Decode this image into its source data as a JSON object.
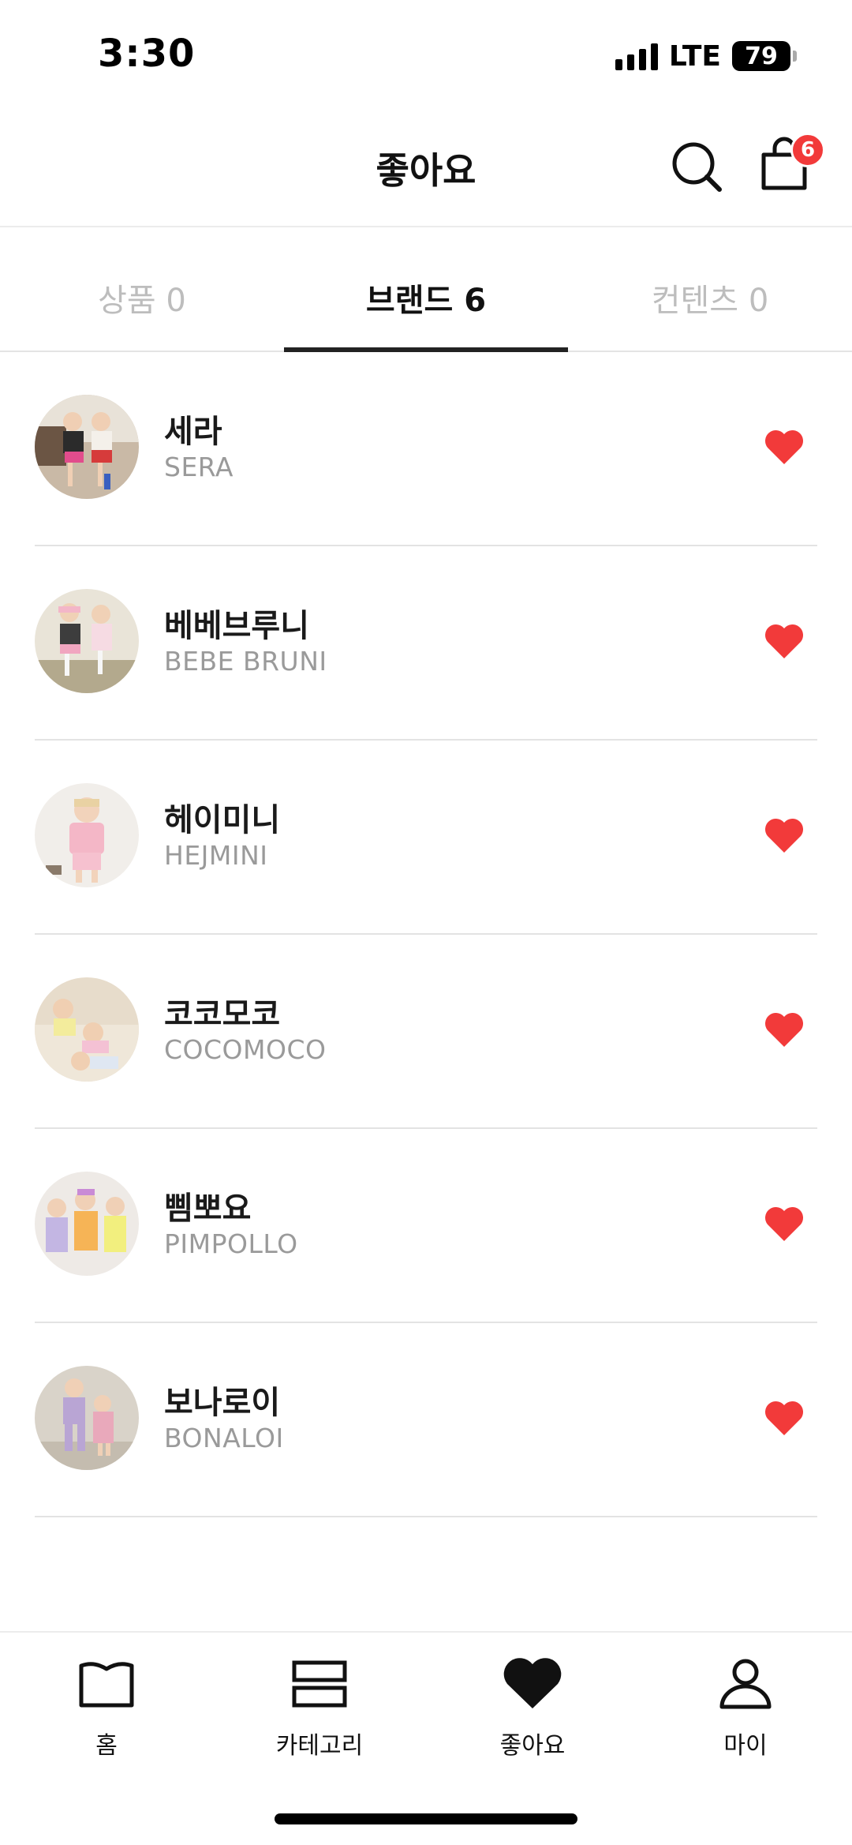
{
  "status_bar": {
    "time": "3:30",
    "network": "LTE",
    "battery": "79"
  },
  "header": {
    "title": "좋아요",
    "cart_count": "6"
  },
  "tabs": [
    {
      "label": "상품 0",
      "active": false
    },
    {
      "label": "브랜드 6",
      "active": true
    },
    {
      "label": "컨텐츠 0",
      "active": false
    }
  ],
  "brands": [
    {
      "name": "세라",
      "en": "SERA"
    },
    {
      "name": "베베브루니",
      "en": "BEBE BRUNI"
    },
    {
      "name": "헤이미니",
      "en": "HEJMINI"
    },
    {
      "name": "코코모코",
      "en": "COCOMOCO"
    },
    {
      "name": "삠뽀요",
      "en": "PIMPOLLO"
    },
    {
      "name": "보나로이",
      "en": "BONALOI"
    }
  ],
  "bottom_nav": [
    {
      "label": "홈",
      "icon": "home-book-icon"
    },
    {
      "label": "카테고리",
      "icon": "category-icon"
    },
    {
      "label": "좋아요",
      "icon": "heart-icon"
    },
    {
      "label": "마이",
      "icon": "person-icon"
    }
  ],
  "colors": {
    "heart": "#f23a3a",
    "badge": "#f23a3a",
    "active_tab_underline": "#222222"
  }
}
